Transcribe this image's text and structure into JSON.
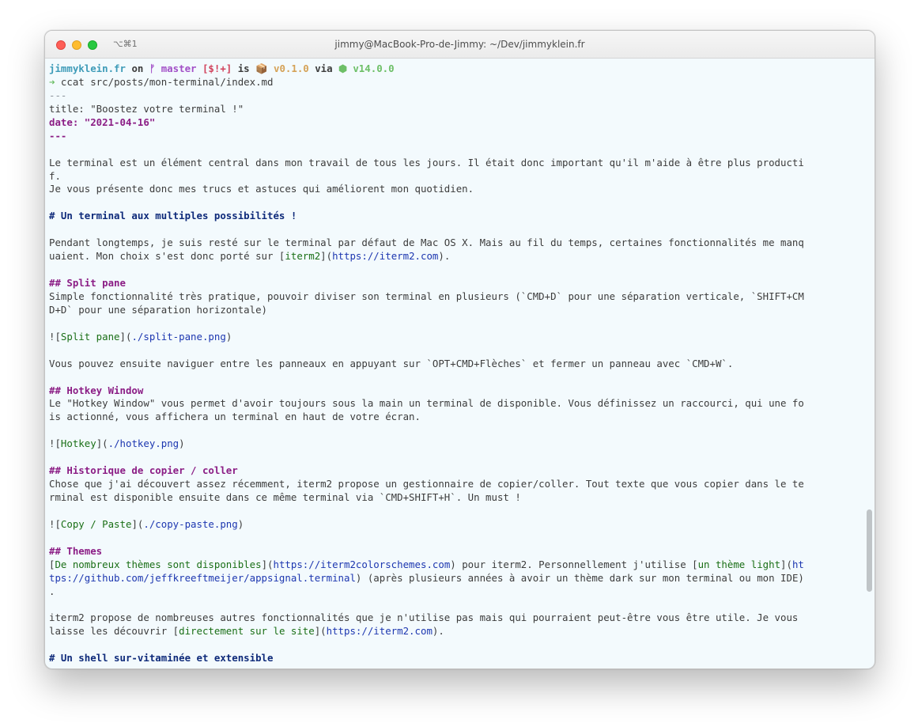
{
  "window": {
    "shortcut": "⌥⌘1",
    "title": "jimmy@MacBook-Pro-de-Jimmy: ~/Dev/jimmyklein.fr"
  },
  "prompt": {
    "dir": "jimmyklein.fr",
    "on": " on ",
    "branch_icon": "ᚠ",
    "branch": " master",
    "status": " [$!+]",
    "is": " is ",
    "package_icon": "📦",
    "version": " v0.1.0",
    "via": " via ",
    "node_icon": "⬢",
    "node_version": " v14.0.0",
    "arrow": "➜",
    "command": " ccat src/posts/mon-terminal/index.md"
  },
  "doc": {
    "fm_open": "---",
    "fm_title": "title: \"Boostez votre terminal !\"",
    "fm_date": "date: \"2021-04-16\"",
    "fm_close": "---",
    "intro1a": "Le terminal est un élément central dans mon travail de tous les jours. Il était donc important qu'il m'aide à être plus producti",
    "intro1b": "f.",
    "intro2": "Je vous présente donc mes trucs et astuces qui améliorent mon quotidien.",
    "h1": "# Un terminal aux multiples possibilités !",
    "p1a": "Pendant longtemps, je suis resté sur le terminal par défaut de Mac OS X. Mais au fil du temps, certaines fonctionnalités me manq",
    "p1b_pre": "uaient. Mon choix s'est donc porté sur [",
    "p1b_link": "iterm2",
    "p1b_mid": "](",
    "p1b_url": "https://iterm2.com",
    "p1b_post": ").",
    "h2_split": "## Split pane",
    "split_a": "Simple fonctionnalité très pratique, pouvoir diviser son terminal en plusieurs (`CMD+D` pour une séparation verticale, `SHIFT+CM",
    "split_b": "D+D` pour une séparation horizontale)",
    "img_split_pre": "![",
    "img_split_alt": "Split pane",
    "img_split_mid": "](",
    "img_split_url": "./split-pane.png",
    "img_split_post": ")",
    "split_nav": "Vous pouvez ensuite naviguer entre les panneaux en appuyant sur `OPT+CMD+Flèches` et fermer un panneau avec `CMD+W`.",
    "h2_hotkey": "## Hotkey Window",
    "hotkey_a": "Le \"Hotkey Window\" vous permet d'avoir toujours sous la main un terminal de disponible. Vous définissez un raccourci, qui une fo",
    "hotkey_b": "is actionné, vous affichera un terminal en haut de votre écran.",
    "img_hotkey_pre": "![",
    "img_hotkey_alt": "Hotkey",
    "img_hotkey_mid": "](",
    "img_hotkey_url": "./hotkey.png",
    "img_hotkey_post": ")",
    "h2_hist": "## Historique de copier / coller",
    "hist_a": "Chose que j'ai découvert assez récemment, iterm2 propose un gestionnaire de copier/coller. Tout texte que vous copier dans le te",
    "hist_b": "rminal est disponible ensuite dans ce même terminal via `CMD+SHIFT+H`. Un must !",
    "img_copy_pre": "![",
    "img_copy_alt": "Copy / Paste",
    "img_copy_mid": "](",
    "img_copy_url": "./copy-paste.png",
    "img_copy_post": ")",
    "h2_themes": "## Themes",
    "themes_a_pre": "[",
    "themes_a_link": "De nombreux thèmes sont disponibles",
    "themes_a_mid": "](",
    "themes_a_url": "https://iterm2colorschemes.com",
    "themes_a_text": ") pour iterm2. Personnellement j'utilise [",
    "themes_a_link2": "un thème light",
    "themes_a_mid2": "](",
    "themes_a_url2": "ht",
    "themes_b_url": "tps://github.com/jeffkreeftmeijer/appsignal.terminal",
    "themes_b_text": ") (après plusieurs années à avoir un thème dark sur mon terminal ou mon IDE)",
    "themes_c": ".",
    "outro_a": "iterm2 propose de nombreuses autres fonctionnalités que je n'utilise pas mais qui pourraient peut-être vous être utile. Je vous",
    "outro_b_pre": "laisse les découvrir [",
    "outro_b_link": "directement sur le site",
    "outro_b_mid": "](",
    "outro_b_url": "https://iterm2.com",
    "outro_b_post": ").",
    "h1_shell": "# Un shell sur-vitaminée et extensible"
  }
}
